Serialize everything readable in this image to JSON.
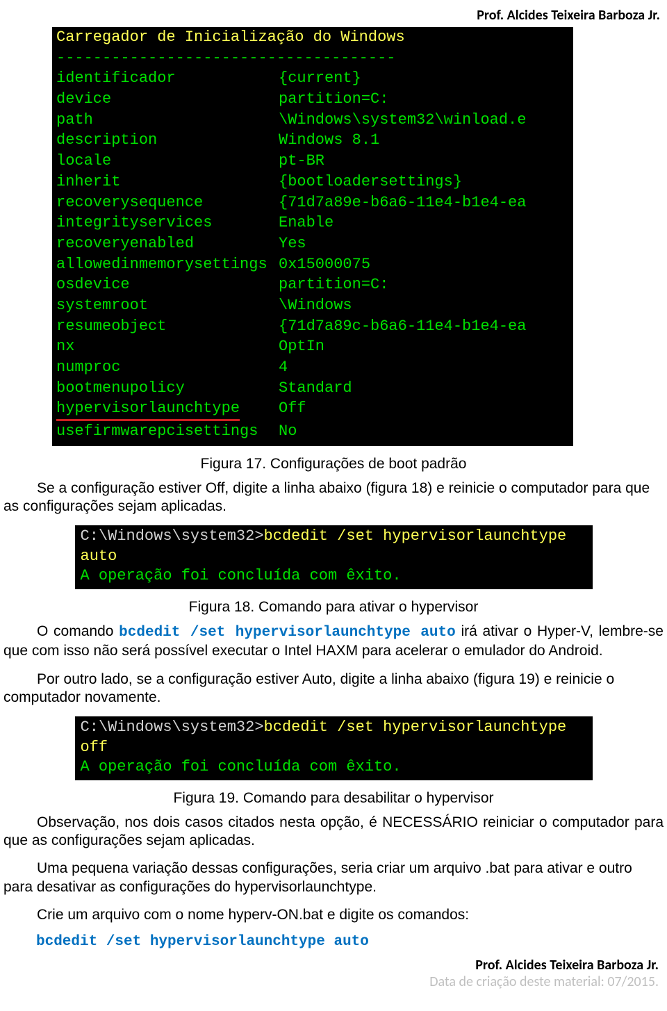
{
  "header_author": "Prof. Alcides Teixeira Barboza Jr.",
  "terminal1": {
    "title": "Carregador de Inicialização do Windows",
    "dashes": "-------------------------------------",
    "rows": [
      {
        "key": "identificador",
        "val": "{current}"
      },
      {
        "key": "device",
        "val": "partition=C:"
      },
      {
        "key": "path",
        "val": "\\Windows\\system32\\winload.e"
      },
      {
        "key": "description",
        "val": "Windows 8.1"
      },
      {
        "key": "locale",
        "val": "pt-BR"
      },
      {
        "key": "inherit",
        "val": "{bootloadersettings}"
      },
      {
        "key": "recoverysequence",
        "val": "{71d7a89e-b6a6-11e4-b1e4-ea"
      },
      {
        "key": "integrityservices",
        "val": "Enable"
      },
      {
        "key": "recoveryenabled",
        "val": "Yes"
      },
      {
        "key": "allowedinmemorysettings",
        "val": "0x15000075"
      },
      {
        "key": "osdevice",
        "val": "partition=C:"
      },
      {
        "key": "systemroot",
        "val": "\\Windows"
      },
      {
        "key": "resumeobject",
        "val": "{71d7a89c-b6a6-11e4-b1e4-ea"
      },
      {
        "key": "nx",
        "val": "OptIn"
      },
      {
        "key": "numproc",
        "val": "4"
      },
      {
        "key": "bootmenupolicy",
        "val": "Standard"
      },
      {
        "key": "hypervisorlaunchtype",
        "val": "Off",
        "underline": true
      },
      {
        "key": "usefirmwarepcisettings",
        "val": "No"
      }
    ]
  },
  "caption1": "Figura 17. Configurações de boot padrão",
  "para1": "Se a configuração estiver Off, digite a linha abaixo (figura 18) e reinicie o computador para que as configurações sejam aplicadas.",
  "cmd1": {
    "prompt": "C:\\Windows\\system32>",
    "command": "bcdedit /set hypervisorlaunchtype auto",
    "result": "A operação foi concluída com êxito."
  },
  "caption2": "Figura 18. Comando para ativar o hypervisor",
  "para2a": "O comando ",
  "para2_cmd": "bcdedit /set hypervisorlaunchtype auto",
  "para2b": " irá ativar o Hyper-V, lembre-se que com isso não será possível executar o Intel HAXM para acelerar o emulador do Android.",
  "para3": "Por outro lado, se a configuração estiver Auto, digite a linha abaixo (figura 19) e reinicie o computador novamente.",
  "cmd2": {
    "prompt": "C:\\Windows\\system32>",
    "command": "bcdedit /set hypervisorlaunchtype off",
    "result": "A operação foi concluída com êxito."
  },
  "caption3": "Figura 19. Comando para desabilitar o hypervisor",
  "para4": "Observação, nos dois casos citados nesta opção, é NECESSÁRIO reiniciar o computador para que as configurações sejam aplicadas.",
  "para5": "Uma pequena variação dessas configurações, seria criar um arquivo .bat para ativar e outro para desativar as configurações do hypervisorlaunchtype.",
  "para6": "Crie um arquivo com o nome hyperv-ON.bat e digite os comandos:",
  "cmd_standalone": "bcdedit /set hypervisorlaunchtype auto",
  "footer_author": "Prof. Alcides Teixeira Barboza Jr.",
  "footer_date": "Data de criação deste material: 07/2015."
}
